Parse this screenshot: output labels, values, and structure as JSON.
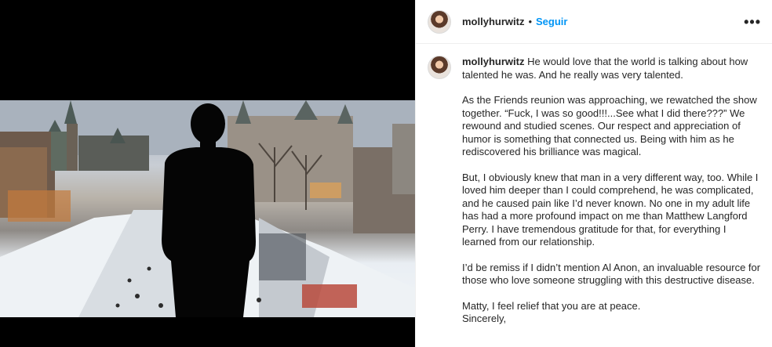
{
  "post": {
    "header": {
      "username": "mollyhurwitz",
      "separator": "•",
      "follow_label": "Seguir",
      "more_icon": "more-options-icon"
    },
    "caption": {
      "username": "mollyhurwitz",
      "first_paragraph": "He would love that the world is talking about how talented he was. And he really was very talented.",
      "paragraphs": [
        "As the Friends reunion was approaching, we rewatched the show together. “Fuck, I was so good!!!...See what I did there???” We rewound and studied scenes. Our respect and appreciation of humor is something that connected us. Being with him as he rediscovered his brilliance was magical.",
        "But, I obviously knew that man in a very different way, too. While I loved him deeper than I could comprehend, he was complicated, and he caused pain like I’d never known. No one in my adult life has had a more profound impact on me than Matthew Langford Perry. I have tremendous gratitude for that, for everything I learned from our relationship.",
        "I’d be remiss if I didn’t mention Al Anon, an invaluable resource for those who love someone struggling with this destructive disease."
      ],
      "closing_1": "Matty, I feel relief that you are at peace.",
      "closing_2": "Sincerely,"
    }
  },
  "colors": {
    "accent": "#0095f6",
    "text": "#262626",
    "divider": "#efefef"
  }
}
